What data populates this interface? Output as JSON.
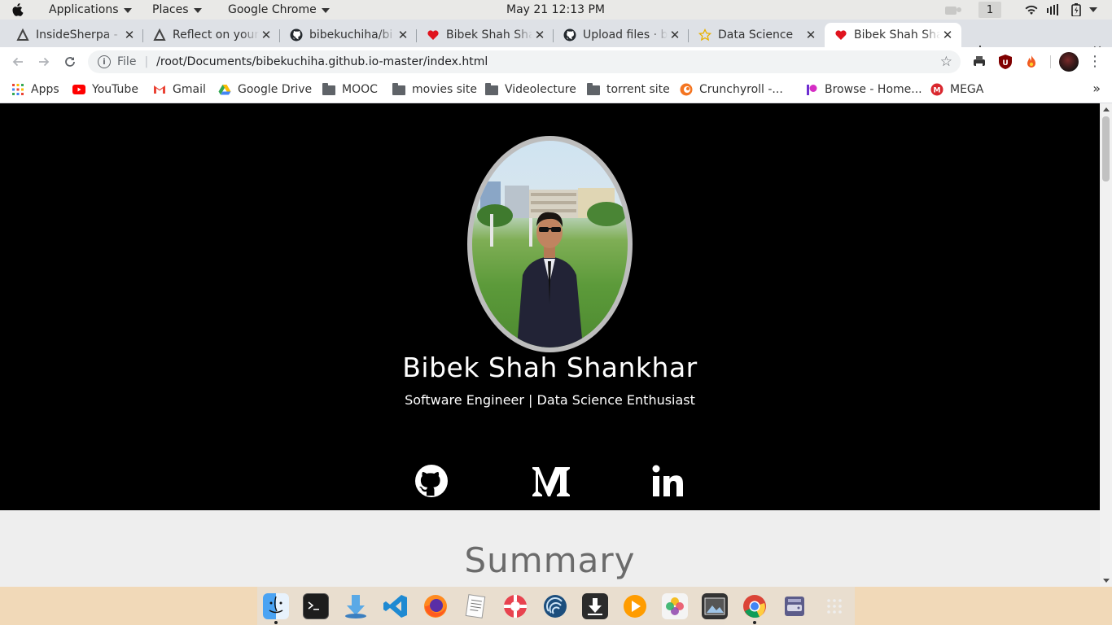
{
  "topbar": {
    "applications": "Applications",
    "places": "Places",
    "app_menu": "Google Chrome",
    "clock": "May 21  12:13 PM",
    "workspace": "1"
  },
  "tabs": [
    {
      "title": "InsideSherpa - ",
      "icon": "insidesherpa-icon"
    },
    {
      "title": "Reflect on your ",
      "icon": "insidesherpa-icon"
    },
    {
      "title": "bibekuchiha/bi",
      "icon": "github-icon"
    },
    {
      "title": "Bibek Shah Sha",
      "icon": "heart-icon"
    },
    {
      "title": "Upload files · bi",
      "icon": "github-icon"
    },
    {
      "title": "Data Science",
      "icon": "star-icon"
    },
    {
      "title": "Bibek Shah Sha",
      "icon": "heart-icon",
      "active": true
    }
  ],
  "omnibox": {
    "scheme": "File",
    "divider": "|",
    "url": "/root/Documents/bibekuchiha.github.io-master/index.html"
  },
  "bookmarks": [
    {
      "label": "Apps",
      "icon": "apps-grid-icon"
    },
    {
      "label": "YouTube",
      "icon": "youtube-icon"
    },
    {
      "label": "Gmail",
      "icon": "gmail-icon"
    },
    {
      "label": "Google Drive",
      "icon": "google-drive-icon"
    },
    {
      "label": "MOOC",
      "icon": "folder-icon"
    },
    {
      "label": "movies site",
      "icon": "folder-icon"
    },
    {
      "label": "Videolecture",
      "icon": "folder-icon"
    },
    {
      "label": "torrent site",
      "icon": "folder-icon"
    },
    {
      "label": "Crunchyroll -...",
      "icon": "crunchyroll-icon"
    },
    {
      "label": "Browse - Home...",
      "icon": "patreon-icon"
    },
    {
      "label": "MEGA",
      "icon": "mega-icon"
    }
  ],
  "page": {
    "name": "Bibek Shah Shankhar",
    "tagline": "Software Engineer | Data Science Enthusiast",
    "section_title": "Summary",
    "social": [
      "github-icon",
      "medium-icon",
      "linkedin-icon"
    ]
  },
  "colors": {
    "hero_bg": "#000000",
    "page_bg": "#eeeeee",
    "tab_strip": "#dee1e6"
  }
}
